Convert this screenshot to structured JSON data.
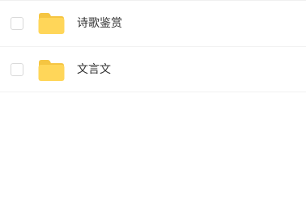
{
  "file_list": {
    "items": [
      {
        "name": "诗歌鉴赏",
        "type": "folder",
        "icon": "folder-icon",
        "checked": false
      },
      {
        "name": "文言文",
        "type": "folder",
        "icon": "folder-icon",
        "checked": false
      }
    ]
  },
  "colors": {
    "folder_body": "#FFD659",
    "folder_tab": "#F5C542",
    "text": "#333333",
    "divider": "#F2F2F2",
    "checkbox_border": "#D9D9D9"
  }
}
